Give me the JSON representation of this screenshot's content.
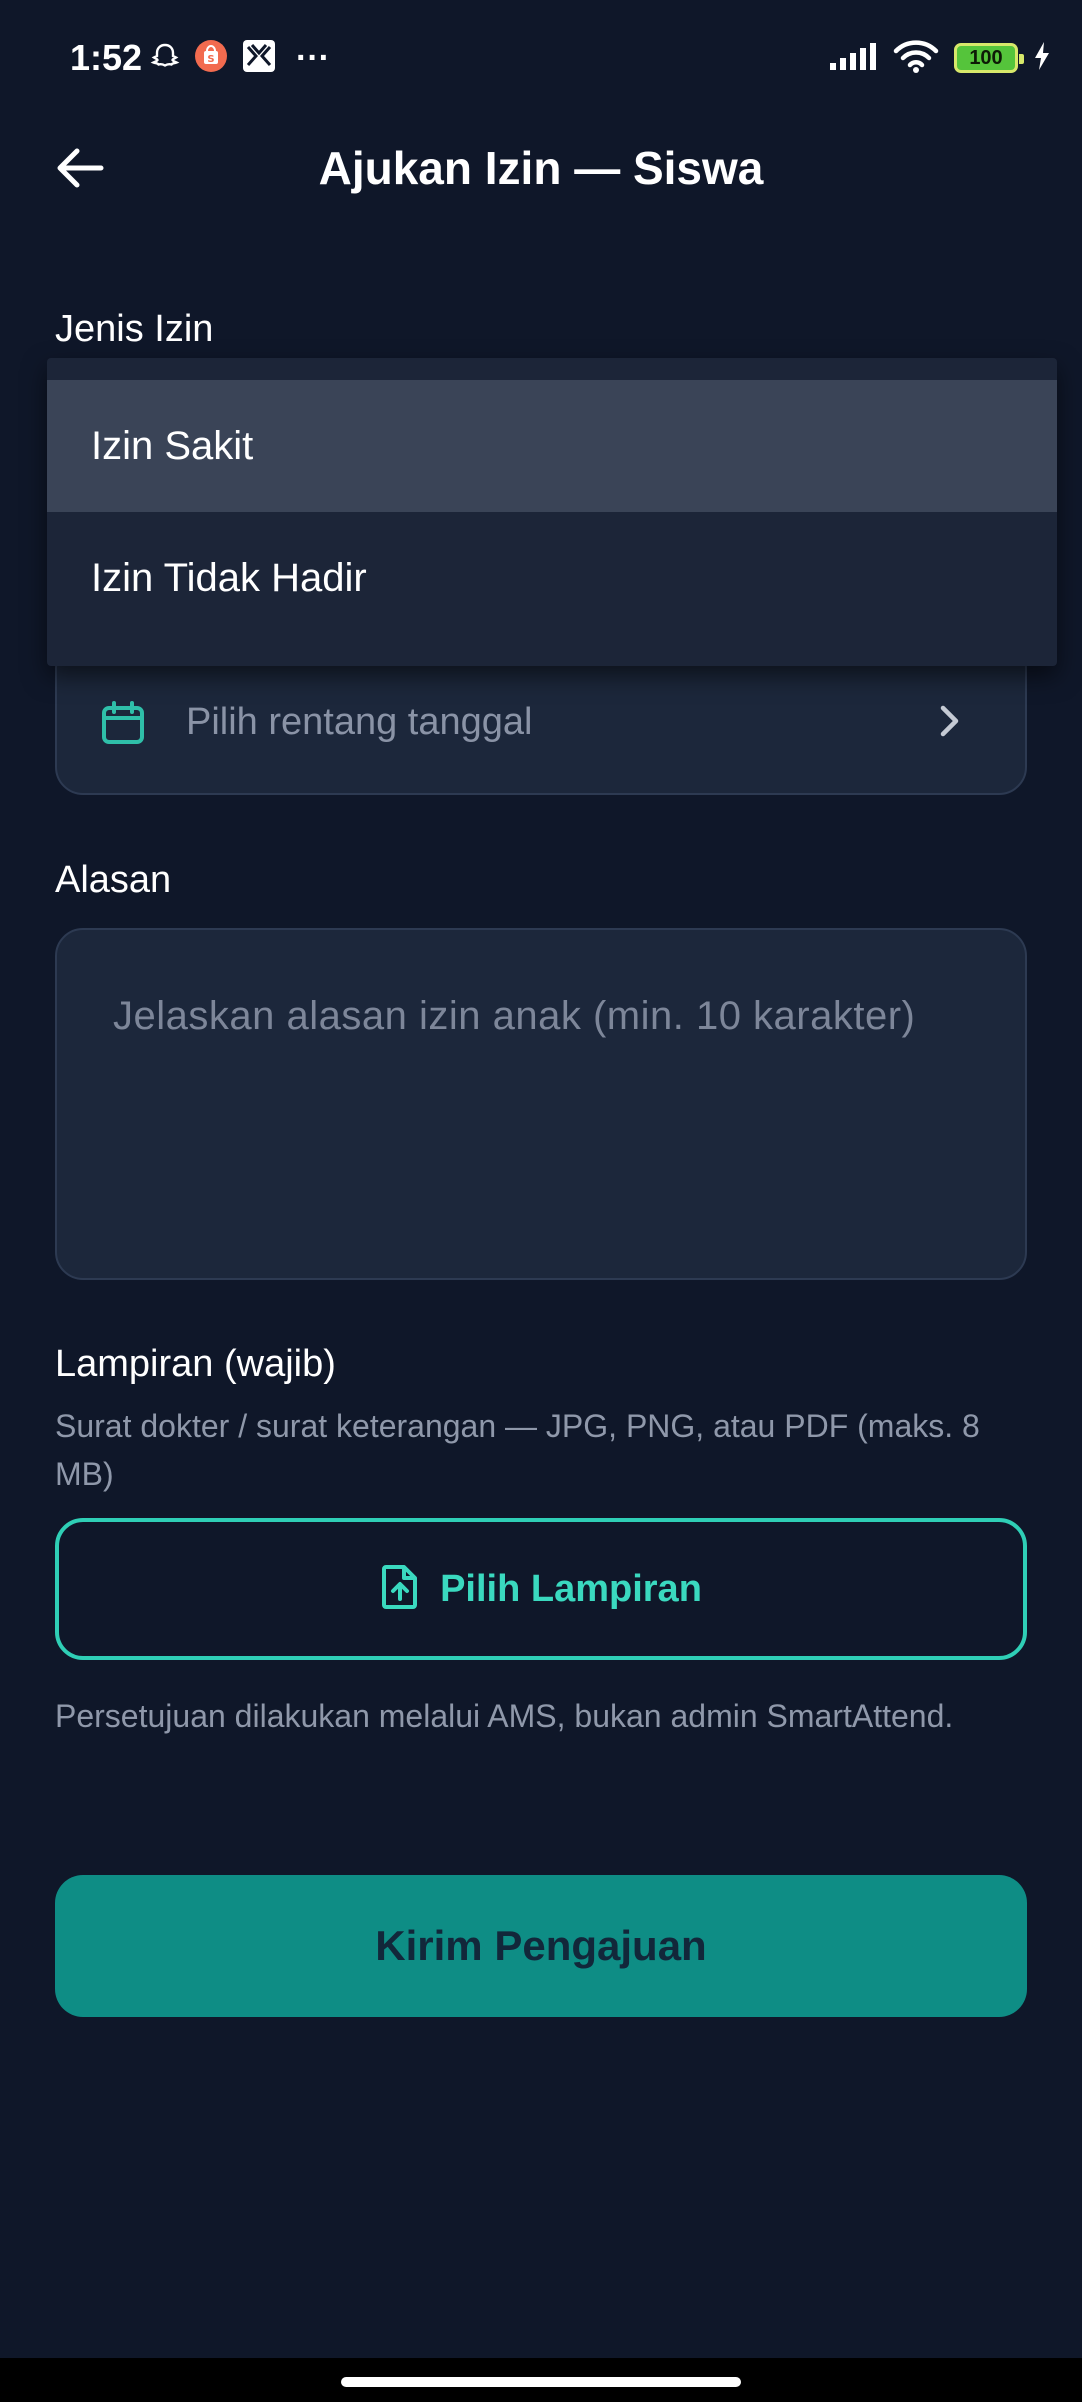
{
  "status_bar": {
    "time": "1:52",
    "overflow": "···",
    "battery": "100",
    "icons_left": [
      "snapchat-icon",
      "shopee-icon",
      "app-icon"
    ],
    "icons_right": [
      "signal-icon",
      "wifi-icon",
      "battery-icon",
      "charging-icon"
    ]
  },
  "header": {
    "title": "Ajukan Izin — Siswa",
    "back_icon": "arrow-left-icon"
  },
  "form": {
    "type_label": "Jenis Izin",
    "type_options": [
      "Izin Sakit",
      "Izin Tidak Hadir"
    ],
    "type_highlighted": "Izin Sakit",
    "date_placeholder": "Pilih rentang tanggal",
    "reason_label": "Alasan",
    "reason_placeholder": "Jelaskan alasan izin anak (min. 10 karakter)",
    "attachment_label": "Lampiran (wajib)",
    "attachment_hint": "Surat dokter / surat keterangan — JPG, PNG, atau PDF (maks. 8 MB)",
    "attachment_button": "Pilih Lampiran",
    "approval_note": "Persetujuan dilakukan melalui AMS, bukan admin SmartAttend.",
    "submit_button": "Kirim Pengajuan"
  },
  "colors": {
    "background": "#0f1729",
    "field": "#1c273b",
    "accent": "#2fcfb6",
    "submit": "#0e8d85"
  }
}
